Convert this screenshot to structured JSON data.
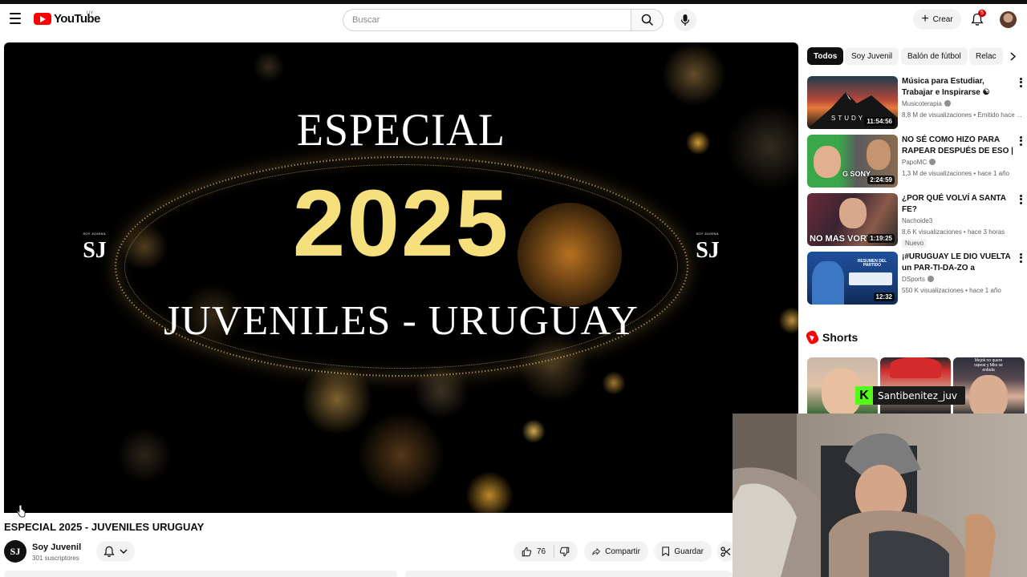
{
  "masthead": {
    "logo_text": "YouTube",
    "logo_region": "UY",
    "search_placeholder": "Buscar",
    "create_label": "Crear",
    "notification_count": "5"
  },
  "player": {
    "title_line1": "ESPECIAL",
    "title_year": "2025",
    "title_line3": "JUVENILES - URUGUAY",
    "watermark_caption": "SOY JUVENIL",
    "watermark_mark": "SJ"
  },
  "video": {
    "title": "ESPECIAL 2025 - JUVENILES URUGUAY",
    "channel_name": "Soy Juvenil",
    "channel_subs": "301 suscriptores",
    "channel_avatar_mark": "SJ",
    "likes": "76",
    "share_label": "Compartir",
    "save_label": "Guardar"
  },
  "chips": [
    {
      "label": "Todos",
      "active": true
    },
    {
      "label": "Soy Juvenil",
      "active": false
    },
    {
      "label": "Balón de fútbol",
      "active": false
    },
    {
      "label": "Relac",
      "active": false
    }
  ],
  "recommendations": [
    {
      "title": "Música para Estudiar, Trabajar e Inspirarse ☯ Música para ...",
      "channel": "Musicoterapia",
      "meta": "8,8 M de visualizaciones • Emitido hace ...",
      "duration": "11:54:56",
      "thumb_text": "STUDY",
      "badge": ""
    },
    {
      "title": "NO SÉ COMO HIZO PARA RAPEAR DESPUÉS DE ESO | ...",
      "channel": "PapoMC",
      "meta": "1,3 M de visualizaciones • hace 1 año",
      "duration": "2:24:59",
      "thumb_text": "G SONY",
      "badge": ""
    },
    {
      "title": "¿POR QUÉ VOLVÍ A SANTA FE?",
      "channel": "Nachoide3",
      "meta": "8,6 K visualizaciones • hace 3 horas",
      "duration": "1:19:25",
      "thumb_text": "NO MAS VORT",
      "badge": "Nuevo"
    },
    {
      "title": "¡#URUGUAY LE DIO VUELTA un PAR-TI-DA-ZO a #COLOMBIA ...",
      "channel": "DSports",
      "meta": "550 K visualizaciones • hace 1 año",
      "duration": "12:32",
      "thumb_text": "RESUMEN DEL PARTIDO",
      "badge": ""
    }
  ],
  "shorts": {
    "title": "Shorts",
    "third_caption": "Mejok no quere rapear y Mks se enfada"
  },
  "overlay": {
    "kick_letter": "K",
    "streamer_name": "Santibenitez_juv"
  },
  "colors": {
    "brand_red": "#ff0000",
    "gold": "#f6df7d",
    "kick_green": "#53fc18"
  }
}
